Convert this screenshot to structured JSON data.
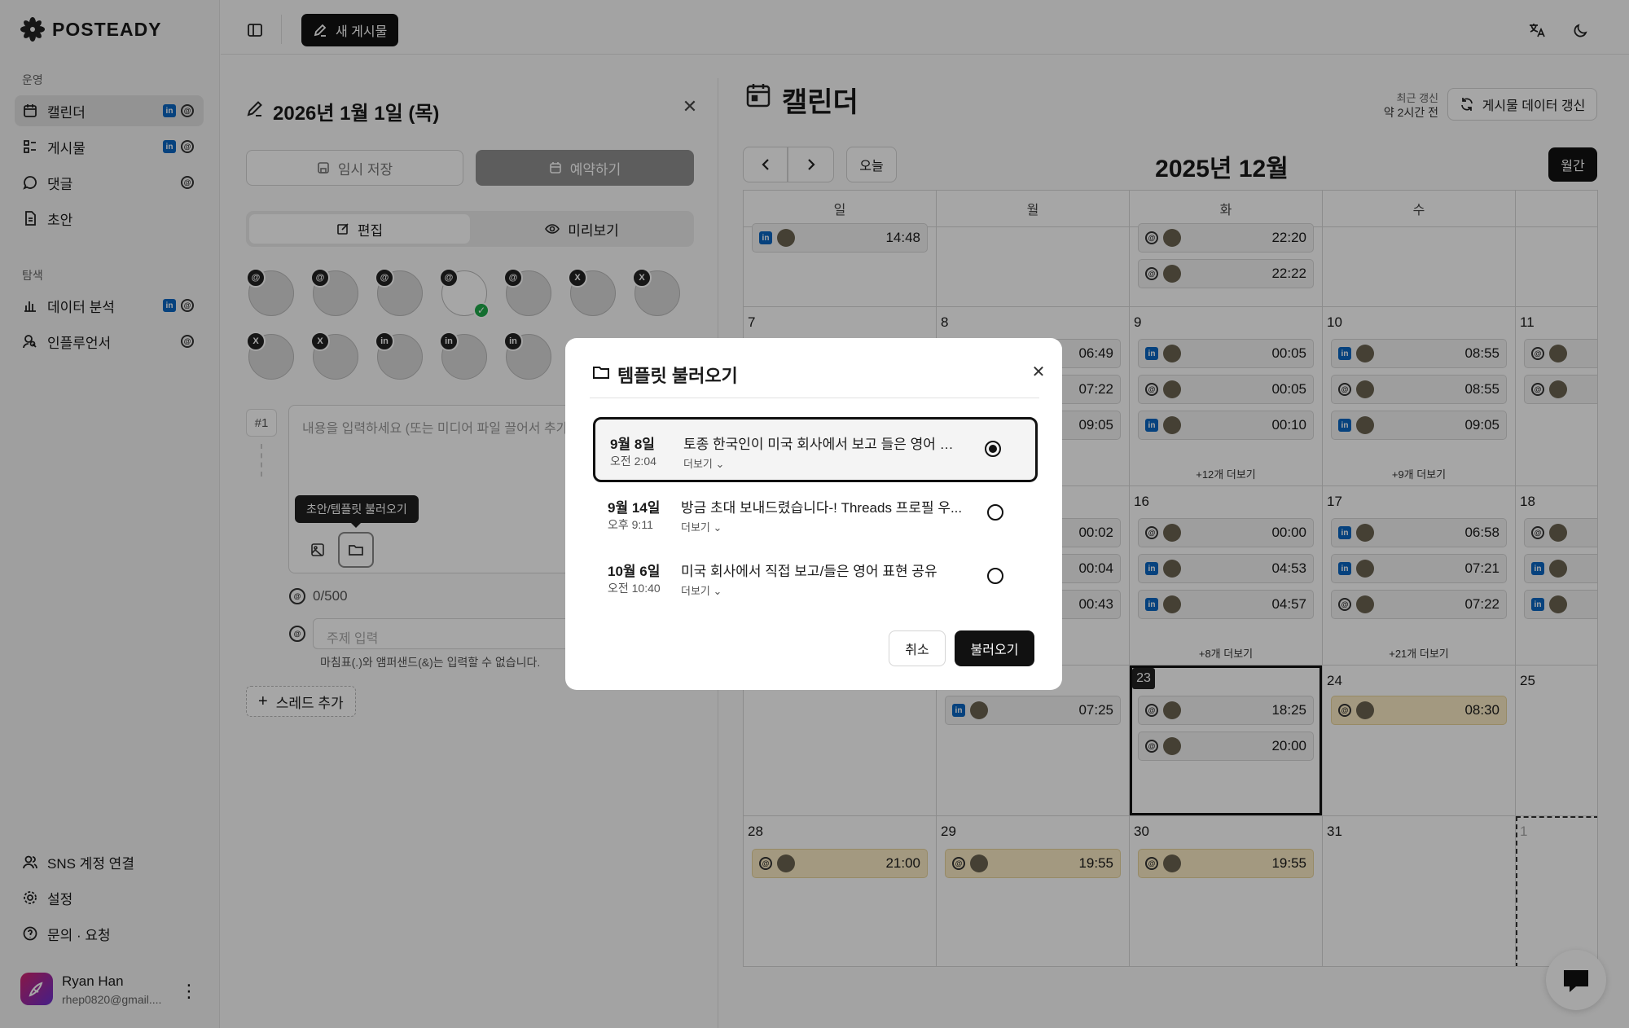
{
  "app": {
    "logo_text": "POSTEADY"
  },
  "sidebar": {
    "section_ops": "운영",
    "section_explore": "탐색",
    "items": [
      {
        "label": "캘린더",
        "icon": "calendar-icon"
      },
      {
        "label": "게시물",
        "icon": "list-icon"
      },
      {
        "label": "댓글",
        "icon": "comment-icon"
      },
      {
        "label": "초안",
        "icon": "document-icon"
      },
      {
        "label": "데이터 분석",
        "icon": "chart-icon"
      },
      {
        "label": "인플루언서",
        "icon": "user-search-icon"
      }
    ],
    "bottom": [
      {
        "label": "SNS 계정 연결"
      },
      {
        "label": "설정"
      },
      {
        "label": "문의 · 요청"
      }
    ],
    "user": {
      "name": "Ryan Han",
      "email": "rhep0820@gmail...."
    }
  },
  "topbar": {
    "new_post": "새 게시물"
  },
  "editor": {
    "title": "2026년 1월 1일 (목)",
    "save_draft": "임시 저장",
    "schedule": "예약하기",
    "tab_edit": "편집",
    "tab_preview": "미리보기",
    "thread_index": "#1",
    "content_placeholder": "내용을 입력하세요 (또는 미디어 파일 끌어서 추가",
    "tooltip": "초안/템플릿 불러오기",
    "char_count": "0/500",
    "topic_placeholder": "주제 입력",
    "topic_hint": "마침표(.)와 앰퍼샌드(&)는 입력할 수 없습니다.",
    "add_thread": "스레드 추가",
    "account_badges": [
      "@",
      "@",
      "@",
      "@",
      "@",
      "X",
      "X",
      "X",
      "X",
      "in",
      "in",
      "in"
    ]
  },
  "calendar": {
    "heading": "캘린더",
    "last_refresh_label": "최근 갱신",
    "last_refresh_value": "약 2시간 전",
    "refresh_button": "게시물 데이터 갱신",
    "today_button": "오늘",
    "month_title": "2025년 12월",
    "view_button": "월간",
    "weekdays": [
      "일",
      "월",
      "화",
      "수"
    ],
    "day_numbers": [
      "7",
      "8",
      "9",
      "10",
      "11",
      "16",
      "17",
      "18",
      "23",
      "24",
      "25",
      "28",
      "29",
      "30",
      "31",
      "1"
    ],
    "event_times": [
      "14:48",
      "22:20",
      "22:22",
      "06:49",
      "07:22",
      "09:05",
      "00:05",
      "00:05",
      "00:10",
      "08:55",
      "08:55",
      "09:05",
      "00:02",
      "00:04",
      "00:43",
      "00:00",
      "04:53",
      "04:57",
      "06:58",
      "07:21",
      "07:22",
      "07:25",
      "18:25",
      "20:00",
      "08:30",
      "21:00",
      "19:55",
      "19:55"
    ],
    "more_links": [
      "+12개 더보기",
      "+9개 더보기",
      "+8개 더보기",
      "+21개 더보기"
    ]
  },
  "modal": {
    "title": "템플릿 불러오기",
    "templates": [
      {
        "date": "9월 8일",
        "time": "오전 2:04",
        "text": "토종 한국인이 미국 회사에서 보고 들은 영어 표현...",
        "more": "더보기",
        "selected": true
      },
      {
        "date": "9월 14일",
        "time": "오후 9:11",
        "text": "방금 초대 보내드렸습니다-! Threads 프로필 우...",
        "more": "더보기",
        "selected": false
      },
      {
        "date": "10월 6일",
        "time": "오전 10:40",
        "text": "미국 회사에서 직접 보고/들은 영어 표현 공유",
        "more": "더보기",
        "selected": false
      }
    ],
    "cancel": "취소",
    "confirm": "불러오기"
  }
}
